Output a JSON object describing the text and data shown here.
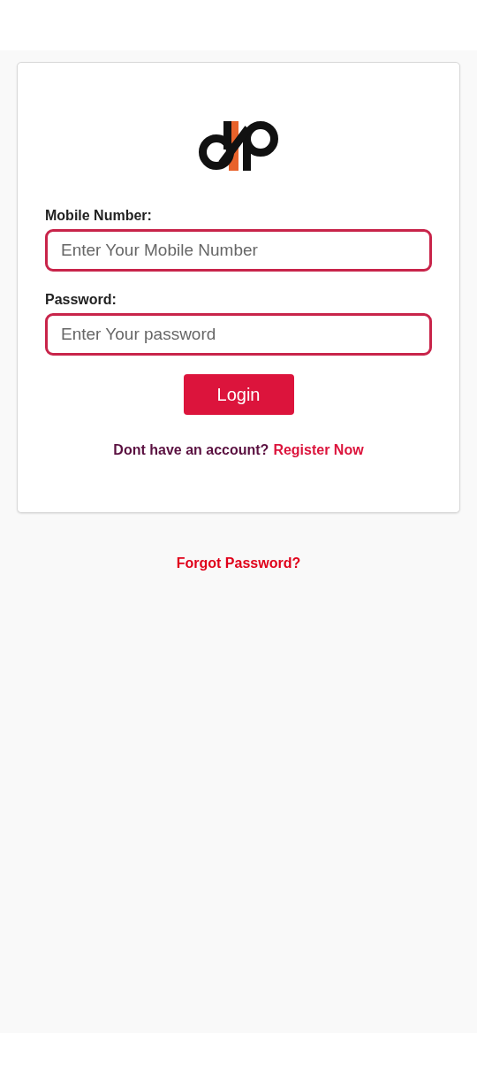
{
  "form": {
    "fields": [
      {
        "label": "Mobile Number:",
        "placeholder": "Enter Your Mobile Number"
      },
      {
        "label": "Password:",
        "placeholder": "Enter Your password"
      }
    ],
    "submit": "Login",
    "register_prompt": "Dont have an account?",
    "register_link": "Register Now"
  },
  "forgot_link": "Forgot Password?"
}
